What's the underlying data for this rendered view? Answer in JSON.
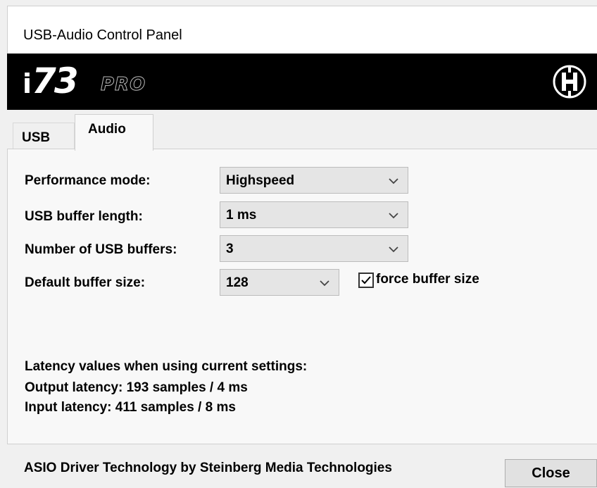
{
  "window": {
    "title": "USB-Audio Control Panel"
  },
  "banner": {
    "logo_i": "i",
    "logo_number": "73",
    "logo_suffix": "PRO",
    "brand_icon": "h-logo-icon"
  },
  "tabs": [
    {
      "label": "USB",
      "selected": false
    },
    {
      "label": "Audio",
      "selected": true
    }
  ],
  "settings": {
    "performance_mode": {
      "label": "Performance mode:",
      "value": "Highspeed"
    },
    "usb_buffer_length": {
      "label": "USB buffer length:",
      "value": "1 ms"
    },
    "number_of_usb_buffers": {
      "label": "Number of USB buffers:",
      "value": "3"
    },
    "default_buffer_size": {
      "label": "Default buffer size:",
      "value": "128"
    },
    "force_buffer_size": {
      "label": "force buffer size",
      "checked": true
    }
  },
  "latency": {
    "heading": "Latency values when using current settings:",
    "output": "Output latency: 193 samples / 4 ms",
    "input": "Input latency: 411 samples / 8 ms"
  },
  "footer": {
    "credit": "ASIO Driver Technology by Steinberg Media Technologies",
    "close_label": "Close"
  },
  "icons": {
    "dropdown": "chevron-down-icon",
    "checkbox": "checkmark-icon"
  }
}
